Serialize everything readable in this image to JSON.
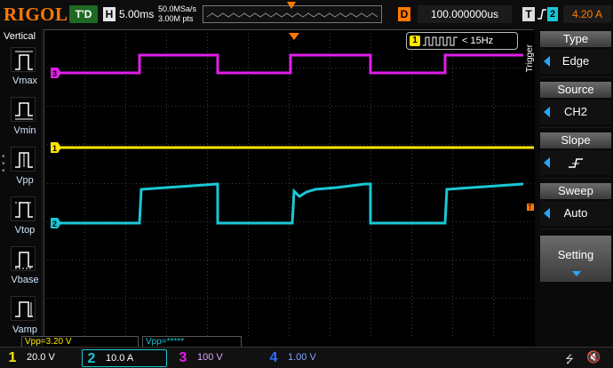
{
  "header": {
    "logo_text": "RIGOL",
    "run_status": "T'D",
    "horizontal_label": "H",
    "time_base": "5.00ms",
    "sample_rate": "50.0MSa/s",
    "memory_depth": "3.00M pts",
    "delay_label": "D",
    "delay_value": "100.000000us",
    "trigger_label": "T",
    "trigger_source_num": "2",
    "trigger_level": "4.20 A"
  },
  "left_panel": {
    "title": "Vertical",
    "items": [
      {
        "label": "Vmax",
        "icon": "vmax-icon"
      },
      {
        "label": "Vmin",
        "icon": "vmin-icon"
      },
      {
        "label": "Vpp",
        "icon": "vpp-icon"
      },
      {
        "label": "Vtop",
        "icon": "vtop-icon"
      },
      {
        "label": "Vbase",
        "icon": "vbase-icon"
      },
      {
        "label": "Vamp",
        "icon": "vamp-icon"
      }
    ]
  },
  "counter": {
    "channel": "1",
    "text": "< 15Hz"
  },
  "channel_markers": {
    "ch1": "1",
    "ch2": "2",
    "ch3": "3",
    "trigger_marker": "T"
  },
  "right_panel": {
    "title": "Trigger",
    "menu": [
      {
        "header": "Type",
        "value": "Edge"
      },
      {
        "header": "Source",
        "value": "CH2"
      },
      {
        "header": "Slope",
        "value": ""
      },
      {
        "header": "Sweep",
        "value": "Auto"
      }
    ],
    "setting_label": "Setting"
  },
  "measurements": {
    "m1": "Vpp=3.20 V",
    "m2": "Vpp=*****"
  },
  "channels": [
    {
      "num": "1",
      "scale": "20.0 V",
      "color": "#ffe600"
    },
    {
      "num": "2",
      "scale": "10.0 A",
      "color": "#18c8d6"
    },
    {
      "num": "3",
      "scale": "100 V",
      "color": "#e11ee8"
    },
    {
      "num": "4",
      "scale": "1.00 V",
      "color": "#2e6dff"
    }
  ],
  "colors": {
    "ch1": "#ffe600",
    "ch2": "#18c8d6",
    "ch3": "#e11ee8",
    "trigger": "#ff7a00",
    "grid": "#4a4a4a"
  },
  "icons": {
    "usb": "usb-icon",
    "speaker": "speaker-muted-icon",
    "slope": "rising-edge-icon"
  }
}
